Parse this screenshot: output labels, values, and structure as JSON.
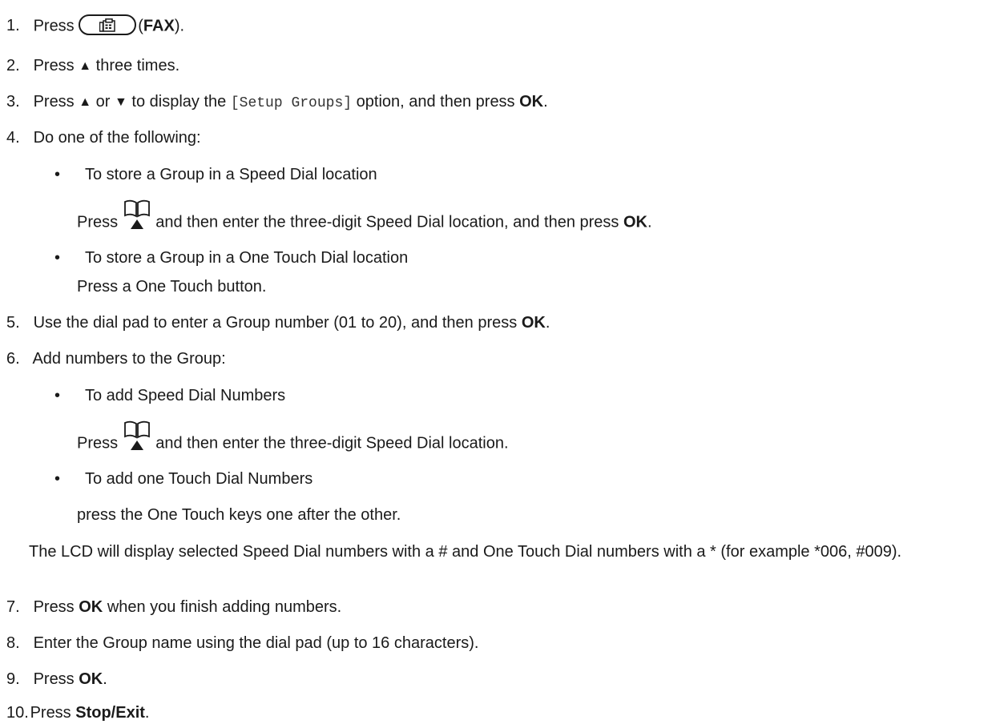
{
  "steps": {
    "s1": {
      "num": "1.",
      "pre": "Press",
      "bold": "FAX",
      "open": "(",
      "close": ").",
      "icon": "fax-key-icon"
    },
    "s2": {
      "num": "2.",
      "pre": "Press",
      "arrow": "▲",
      "post": "three times."
    },
    "s3": {
      "num": "3.",
      "pre": "Press",
      "up": "▲",
      "or": "or",
      "down": "▼",
      "mid": "to display the",
      "code": "[Setup Groups]",
      "post": "option, and then press",
      "bold": "OK",
      "end": "."
    },
    "s4": {
      "num": "4.",
      "text": "Do one of the following:",
      "opt1_title": "To store a Group in a Speed Dial location",
      "opt1_pre": "Press",
      "opt1_icon": "address-book-icon",
      "opt1_post": "and then enter the three-digit Speed Dial location, and then press",
      "opt1_bold": "OK",
      "opt1_end": ".",
      "opt2_title": "To store a Group in a One Touch Dial location",
      "opt2_text": "Press a One Touch button."
    },
    "s5": {
      "num": "5.",
      "pre": "Use the dial pad to enter a Group number (01 to 20), and then press",
      "bold": "OK",
      "end": "."
    },
    "s6": {
      "num": "6.",
      "text": "Add numbers to the Group:",
      "opt1_title": "To add Speed Dial Numbers",
      "opt1_pre": "Press",
      "opt1_post": "and then enter the three-digit Speed Dial location.",
      "opt2_title": "To add one Touch Dial Numbers",
      "opt2_text": "press the One Touch keys one after the other.",
      "note": "The LCD will display selected Speed Dial numbers with a # and One Touch Dial numbers with a * (for example *006, #009)."
    },
    "s7": {
      "num": "7.",
      "pre": "Press",
      "bold": "OK",
      "post": "when you finish adding numbers."
    },
    "s8": {
      "num": "8.",
      "text": "Enter the Group name using the dial pad (up to 16 characters)."
    },
    "s9": {
      "num": "9.",
      "pre": "Press",
      "bold": "OK",
      "end": "."
    },
    "s10": {
      "num": "10.",
      "pre": "Press",
      "bold": "Stop/Exit",
      "end": "."
    }
  },
  "bullet": "•"
}
